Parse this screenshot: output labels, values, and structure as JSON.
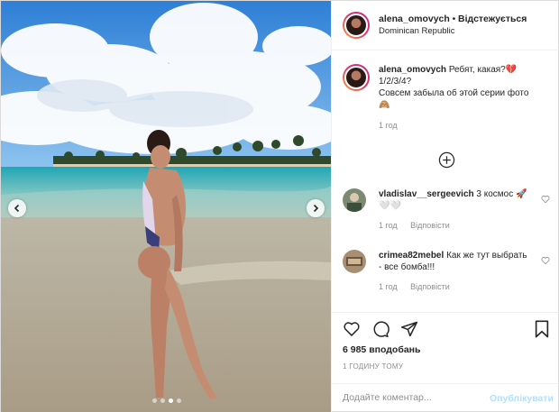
{
  "post": {
    "author": "alena_omovych",
    "separator": "•",
    "follow_label": "Відстежується",
    "location": "Dominican Republic"
  },
  "caption": {
    "username": "alena_omovych",
    "line1": "Ребят, какая?💔",
    "line2": "1/2/3/4?",
    "line3": "Совсем забыла об этой серии фото",
    "line4": "🙈",
    "time": "1 год"
  },
  "comments": [
    {
      "username": "vladislav__sergeevich",
      "text": "3 космос 🚀 🤍🤍",
      "time": "1 год",
      "reply_label": "Відповісти"
    },
    {
      "username": "crimea82mebel",
      "text": "Как же тут выбрать - все бомба!!!",
      "time": "1 год",
      "reply_label": "Відповісти"
    }
  ],
  "likes": "6 985 вподобань",
  "posted": "1 ГОДИНУ ТОМУ",
  "add_comment": {
    "placeholder": "Додайте коментар...",
    "publish_label": "Опублікувати"
  },
  "carousel": {
    "slides": 4,
    "active": 2
  },
  "icons": [
    "chevron-left-icon",
    "chevron-right-icon",
    "plus-circle-icon",
    "heart-icon",
    "comment-icon",
    "share-icon",
    "bookmark-icon"
  ],
  "colors": {
    "border": "#dbdbdb",
    "muted": "#8e8e8e",
    "text": "#262626",
    "publish_disabled": "#b2dffc"
  }
}
